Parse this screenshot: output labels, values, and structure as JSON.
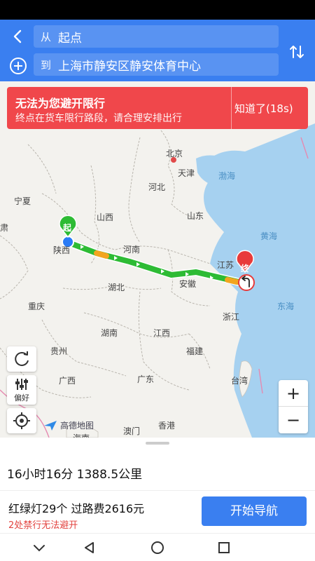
{
  "header": {
    "from_prefix": "从",
    "from_value": "起点",
    "to_prefix": "到",
    "to_value": "上海市静安区静安体育中心"
  },
  "restriction": {
    "title": "无法为您避开限行",
    "subtitle": "终点在货车限行路段，请合理安排出行",
    "dismiss_label": "知道了(18s)"
  },
  "map": {
    "labels": [
      "北京",
      "天津",
      "渤海",
      "河北",
      "宁夏",
      "山西",
      "山东",
      "黄海",
      "肃",
      "起",
      "陕西",
      "河南",
      "江苏",
      "终",
      "安徽",
      "湖北",
      "东海",
      "重庆",
      "浙江",
      "湖南",
      "江西",
      "贵州",
      "福建",
      "广西",
      "广东",
      "台湾",
      "澳门",
      "香港",
      "海南"
    ],
    "logo": "高德地图",
    "preference_label": "偏好",
    "zoom_in": "+",
    "zoom_out": "−",
    "colors": {
      "route_green": "#2dbb34",
      "route_yellow": "#f2a51f",
      "sea": "#a6d1f0"
    }
  },
  "sheet": {
    "summary": "16小时16分 1388.5公里",
    "details": "红绿灯29个 过路费2616元",
    "warning": "2处禁行无法避开",
    "start_label": "开始导航"
  }
}
